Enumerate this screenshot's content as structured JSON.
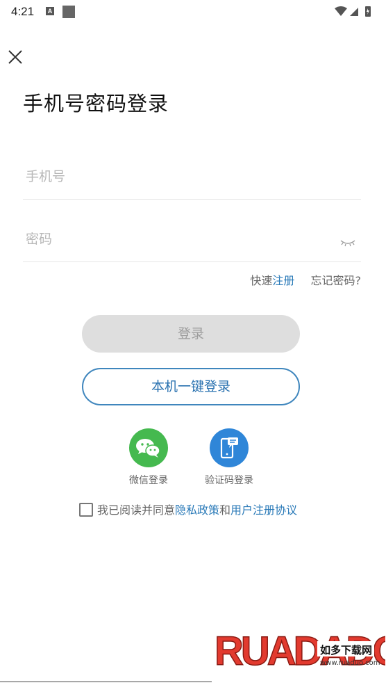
{
  "status_bar": {
    "time": "4:21",
    "notification_letter": "A"
  },
  "header": {
    "title": "手机号密码登录"
  },
  "form": {
    "phone_placeholder": "手机号",
    "password_placeholder": "密码"
  },
  "links": {
    "quick_prefix": "快速",
    "register": "注册",
    "forgot": "忘记密码?"
  },
  "buttons": {
    "login": "登录",
    "one_key_login": "本机一键登录"
  },
  "social": {
    "wechat_label": "微信登录",
    "sms_label": "验证码登录"
  },
  "agreement": {
    "prefix": "我已阅读并同意",
    "privacy": "隐私政策",
    "and": "和",
    "user_agreement": "用户注册协议"
  },
  "watermark": {
    "brand": "RUADADO",
    "tagline": "如多下载网",
    "url": "www.ruaduo.com"
  },
  "colors": {
    "accent": "#2a7ab8",
    "wechat_green": "#45b94f",
    "sms_blue": "#2f86d8",
    "login_disabled_bg": "#dedede"
  }
}
